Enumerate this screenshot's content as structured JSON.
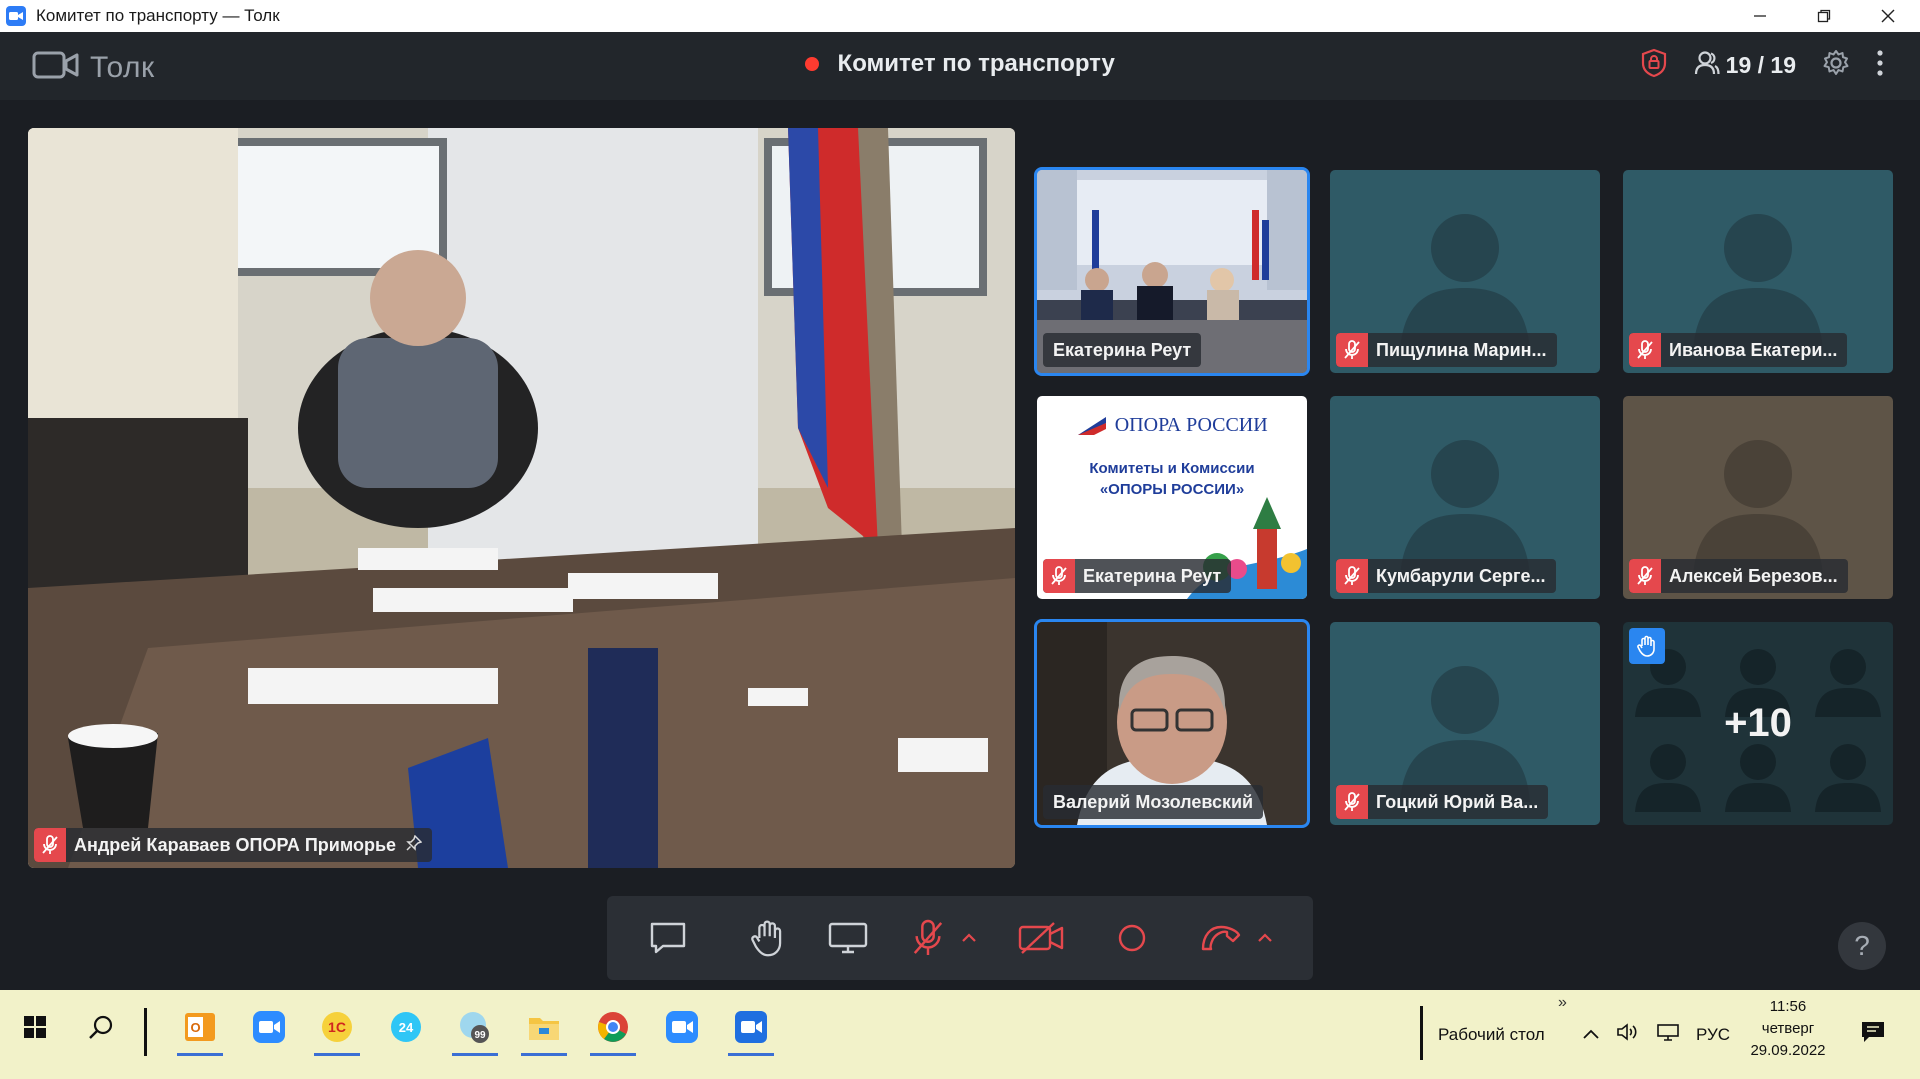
{
  "window": {
    "title": "Комитет по транспорту — Толк",
    "controls": [
      "minimize",
      "restore",
      "close"
    ]
  },
  "header": {
    "brand": "Толк",
    "meeting_title": "Комитет по транспорту",
    "participants_count": "19 / 19",
    "recording_color": "#ff3b30"
  },
  "main_speaker": {
    "name": "Андрей Караваев ОПОРА Приморье",
    "muted": true,
    "pinned": true
  },
  "participants": [
    {
      "name": "Екатерина Реут",
      "muted": false,
      "video": "conference-room",
      "active": true
    },
    {
      "name": "Пищулина Марин...",
      "muted": true,
      "video": "none"
    },
    {
      "name": "Иванова Екатери...",
      "muted": true,
      "video": "none"
    },
    {
      "name": "Екатерина Реут",
      "muted": true,
      "video": "slide",
      "slide_brand": "ОПОРА РОССИИ",
      "slide_text": "Комитеты и Комиссии «ОПОРЫ РОССИИ»"
    },
    {
      "name": "Кумбарули Серге...",
      "muted": true,
      "video": "none"
    },
    {
      "name": "Алексей Березов...",
      "muted": true,
      "video": "none"
    },
    {
      "name": "Валерий Мозолевский",
      "muted": false,
      "video": "camera",
      "active": true
    },
    {
      "name": "Гоцкий Юрий Ва...",
      "muted": true,
      "video": "none"
    },
    {
      "more_count": "+10",
      "hand_raised": true
    }
  ],
  "toolbar": {
    "buttons": [
      "chat-icon",
      "raise-hand-icon",
      "screen-share-icon",
      "microphone-muted-icon",
      "camera-off-icon",
      "record-icon",
      "hang-up-icon"
    ],
    "help_label": "?"
  },
  "taskbar": {
    "apps": [
      "outlook-icon",
      "zoom-icon",
      "1c-icon",
      "bitrix24-icon",
      "bitrix-messenger-icon",
      "file-explorer-icon",
      "chrome-icon",
      "zoom-icon",
      "tolk-icon"
    ],
    "badge": "99",
    "desktop_label": "Рабочий стол",
    "language": "РУС",
    "time": "11:56",
    "day": "четверг",
    "date": "29.09.2022",
    "overflow": "»"
  },
  "colors": {
    "accent": "#2a86f0",
    "mute_red": "#e5484d",
    "tile_bg": "#2f5a66",
    "taskbar_bg": "#f2f2c9"
  }
}
